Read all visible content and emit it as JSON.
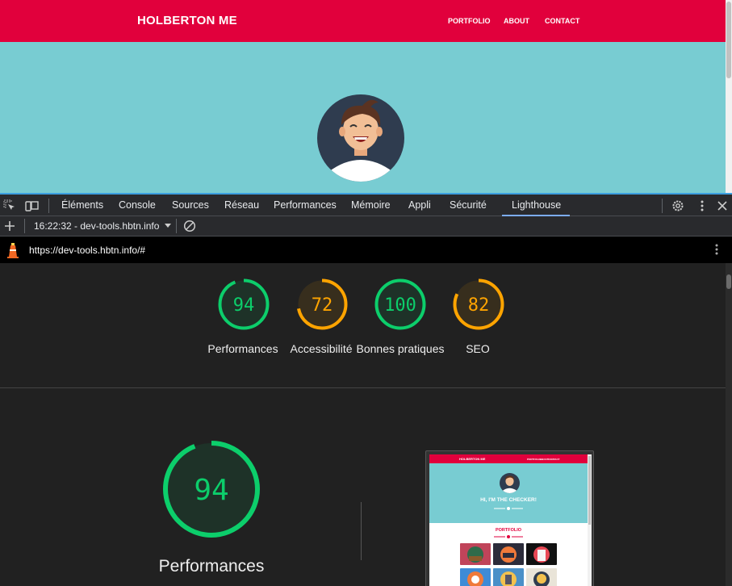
{
  "site": {
    "brand": "HOLBERTON ME",
    "nav": [
      "PORTFOLIO",
      "ABOUT",
      "CONTACT"
    ]
  },
  "devtools": {
    "tabs": [
      "Éléments",
      "Console",
      "Sources",
      "Réseau",
      "Performances",
      "Mémoire",
      "Appli",
      "Sécurité",
      "Lighthouse"
    ],
    "active_tab": "Lighthouse",
    "session": "16:22:32 - dev-tools.hbtn.info",
    "url": "https://dev-tools.hbtn.info/#"
  },
  "scores": [
    {
      "label": "Performances",
      "value": "94",
      "status": "pass"
    },
    {
      "label": "Accessibilité",
      "value": "72",
      "status": "average"
    },
    {
      "label": "Bonnes pratiques",
      "value": "100",
      "status": "pass"
    },
    {
      "label": "SEO",
      "value": "82",
      "status": "average"
    }
  ],
  "main_score": {
    "label": "Performances",
    "value": "94"
  },
  "thumbnail": {
    "brand": "HOLBERTON ME",
    "nav": [
      "PORTFOLIO",
      "ABOUT",
      "CONTACT"
    ],
    "hero": "HI, I'M THE CHECKER!",
    "section": "PORTFOLIO"
  },
  "colors": {
    "pass": "#0cce6b",
    "average": "#ffa400",
    "brand_red": "#e1003c",
    "hero_teal": "#78ccd2"
  }
}
